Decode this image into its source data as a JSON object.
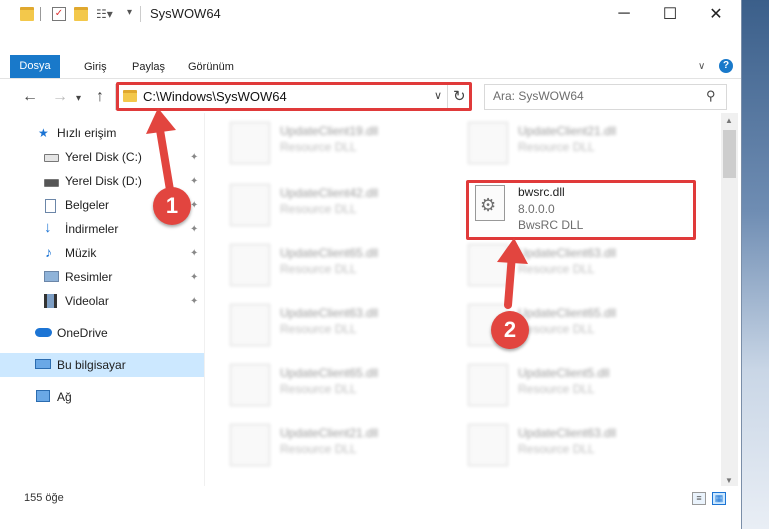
{
  "window": {
    "title": "SysWOW64",
    "minimize": "─",
    "maximize": "☐",
    "close": "✕"
  },
  "ribbon": {
    "tabs": [
      "Dosya",
      "Giriş",
      "Paylaş",
      "Görünüm"
    ],
    "help": "?"
  },
  "address": {
    "path": "C:\\Windows\\SysWOW64",
    "search_placeholder": "Ara: SysWOW64"
  },
  "nav": {
    "items": [
      {
        "label": "Hızlı erişim",
        "icon": "star-icon"
      },
      {
        "label": "Yerel Disk (C:)",
        "icon": "drive-icon",
        "pinned": true
      },
      {
        "label": "Yerel Disk (D:)",
        "icon": "drive-icon",
        "pinned": true
      },
      {
        "label": "Belgeler",
        "icon": "documents-icon",
        "pinned": true
      },
      {
        "label": "İndirmeler",
        "icon": "download-icon",
        "pinned": true
      },
      {
        "label": "Müzik",
        "icon": "music-icon",
        "pinned": true
      },
      {
        "label": "Resimler",
        "icon": "pictures-icon",
        "pinned": true
      },
      {
        "label": "Videolar",
        "icon": "videos-icon",
        "pinned": true
      },
      {
        "label": "OneDrive",
        "icon": "cloud-icon"
      },
      {
        "label": "Bu bilgisayar",
        "icon": "computer-icon",
        "selected": true
      },
      {
        "label": "Ağ",
        "icon": "network-icon"
      }
    ]
  },
  "files": [
    {
      "name": "UpdateClient19.dll",
      "type": "Resource DLL",
      "blurred": true
    },
    {
      "name": "UpdateClient21.dll",
      "type": "Resource DLL",
      "blurred": true
    },
    {
      "name": "UpdateClient42.dll",
      "type": "Resource DLL",
      "blurred": true
    },
    {
      "name": "bwsrc.dll",
      "version": "8.0.0.0",
      "type": "BwsRC DLL",
      "highlighted": true
    },
    {
      "name": "UpdateClient65.dll",
      "type": "Resource DLL",
      "blurred": true
    },
    {
      "name": "UpdateClient63.dll",
      "type": "Resource DLL",
      "blurred": true
    },
    {
      "name": "UpdateClient63.dll",
      "type": "Resource DLL",
      "blurred": true
    },
    {
      "name": "UpdateClient65.dll",
      "type": "Resource DLL",
      "blurred": true
    },
    {
      "name": "UpdateClient65.dll",
      "type": "Resource DLL",
      "blurred": true
    },
    {
      "name": "UpdateClient5.dll",
      "type": "Resource DLL",
      "blurred": true
    },
    {
      "name": "UpdateClient21.dll",
      "type": "Resource DLL",
      "blurred": true
    },
    {
      "name": "UpdateClient63.dll",
      "type": "Resource DLL",
      "blurred": true
    }
  ],
  "status": {
    "count": "155 öğe"
  },
  "annotations": {
    "badge1": "1",
    "badge2": "2",
    "highlight_color": "#e03a3a"
  }
}
